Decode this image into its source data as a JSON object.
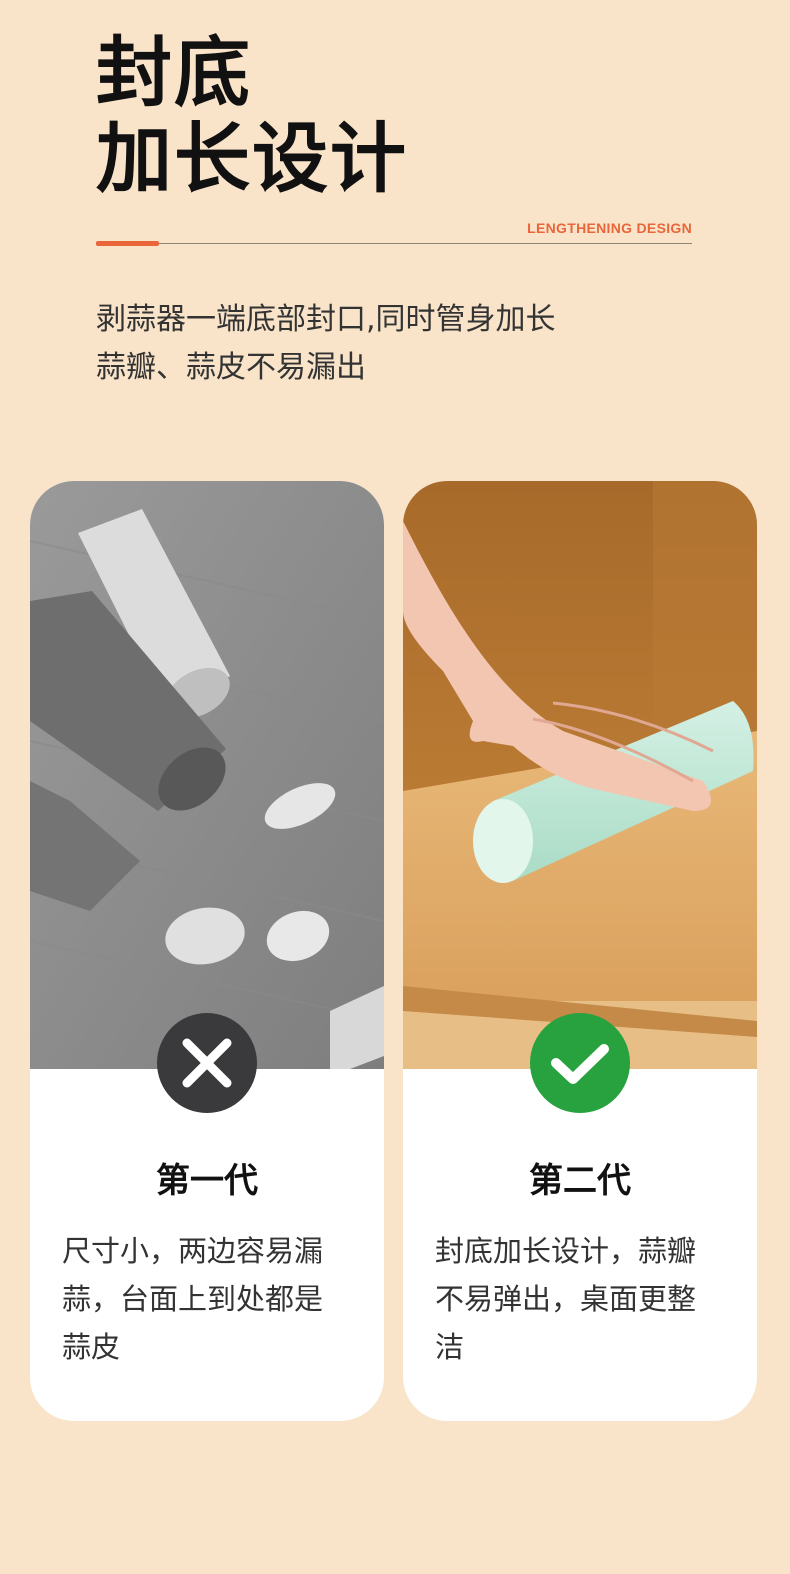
{
  "header": {
    "title_line1": "封底",
    "title_line2": "加长设计",
    "subtitle_en": "LENGTHENING DESIGN",
    "accent_color": "#e8663a"
  },
  "description": {
    "line1": "剥蒜器一端底部封口,同时管身加长",
    "line2": "蒜瓣、蒜皮不易漏出"
  },
  "cards": [
    {
      "title": "第一代",
      "status_icon": "x-icon",
      "status_color": "#3a3a3c",
      "text_lines": [
        "尺寸小，两边容易漏",
        "蒜，台面上到处都是",
        "蒜皮"
      ]
    },
    {
      "title": "第二代",
      "status_icon": "check-icon",
      "status_color": "#27a23f",
      "text_lines": [
        "封底加长设计，蒜瓣",
        "不易弹出，桌面更整",
        "洁"
      ]
    }
  ]
}
